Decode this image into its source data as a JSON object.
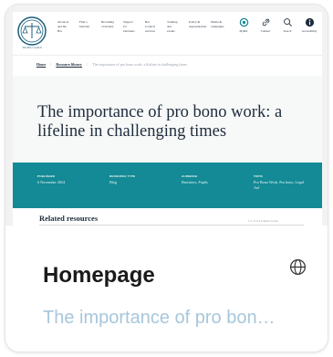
{
  "card": {
    "title": "Homepage",
    "subtitle": "The importance of pro bono work: a lifeline in challenging times",
    "globe_icon": "globe-icon"
  },
  "site": {
    "logo_text": "The Bar Council",
    "nav": [
      {
        "label": "About us and the Bar"
      },
      {
        "label": "Find a barrister"
      },
      {
        "label": "Becoming a barrister"
      },
      {
        "label": "Support for barristers"
      },
      {
        "label": "Bar Council services"
      },
      {
        "label": "Training and events"
      },
      {
        "label": "Policy & representation"
      },
      {
        "label": "Media & campaigns"
      }
    ],
    "icons": [
      {
        "icon": "mybc-icon",
        "label": "MyBar"
      },
      {
        "icon": "link-icon",
        "label": "Connect"
      },
      {
        "icon": "search-icon",
        "label": "Search"
      },
      {
        "icon": "info-icon",
        "label": "Accessibility"
      }
    ],
    "breadcrumb": {
      "home": "Home",
      "resource_library": "Resource library",
      "current": "The importance of pro bono work: a lifeline in challenging times"
    },
    "page_title": "The importance of pro bono work: a lifeline in challenging times",
    "meta": [
      {
        "label": "Published",
        "value": "6 November 2024"
      },
      {
        "label": "Resource type",
        "value": "Blog"
      },
      {
        "label": "Audience",
        "value": "Barristers, Pupils"
      },
      {
        "label": "Topic",
        "value": "Pro Bono Work, Pro bono, Legal Aid"
      }
    ],
    "related_heading": "Related resources",
    "related_note": "1 to 5 of 6 related results",
    "colors": {
      "teal": "#138a95",
      "navy": "#1e2c3c",
      "subtitle": "#a8c6db"
    }
  }
}
